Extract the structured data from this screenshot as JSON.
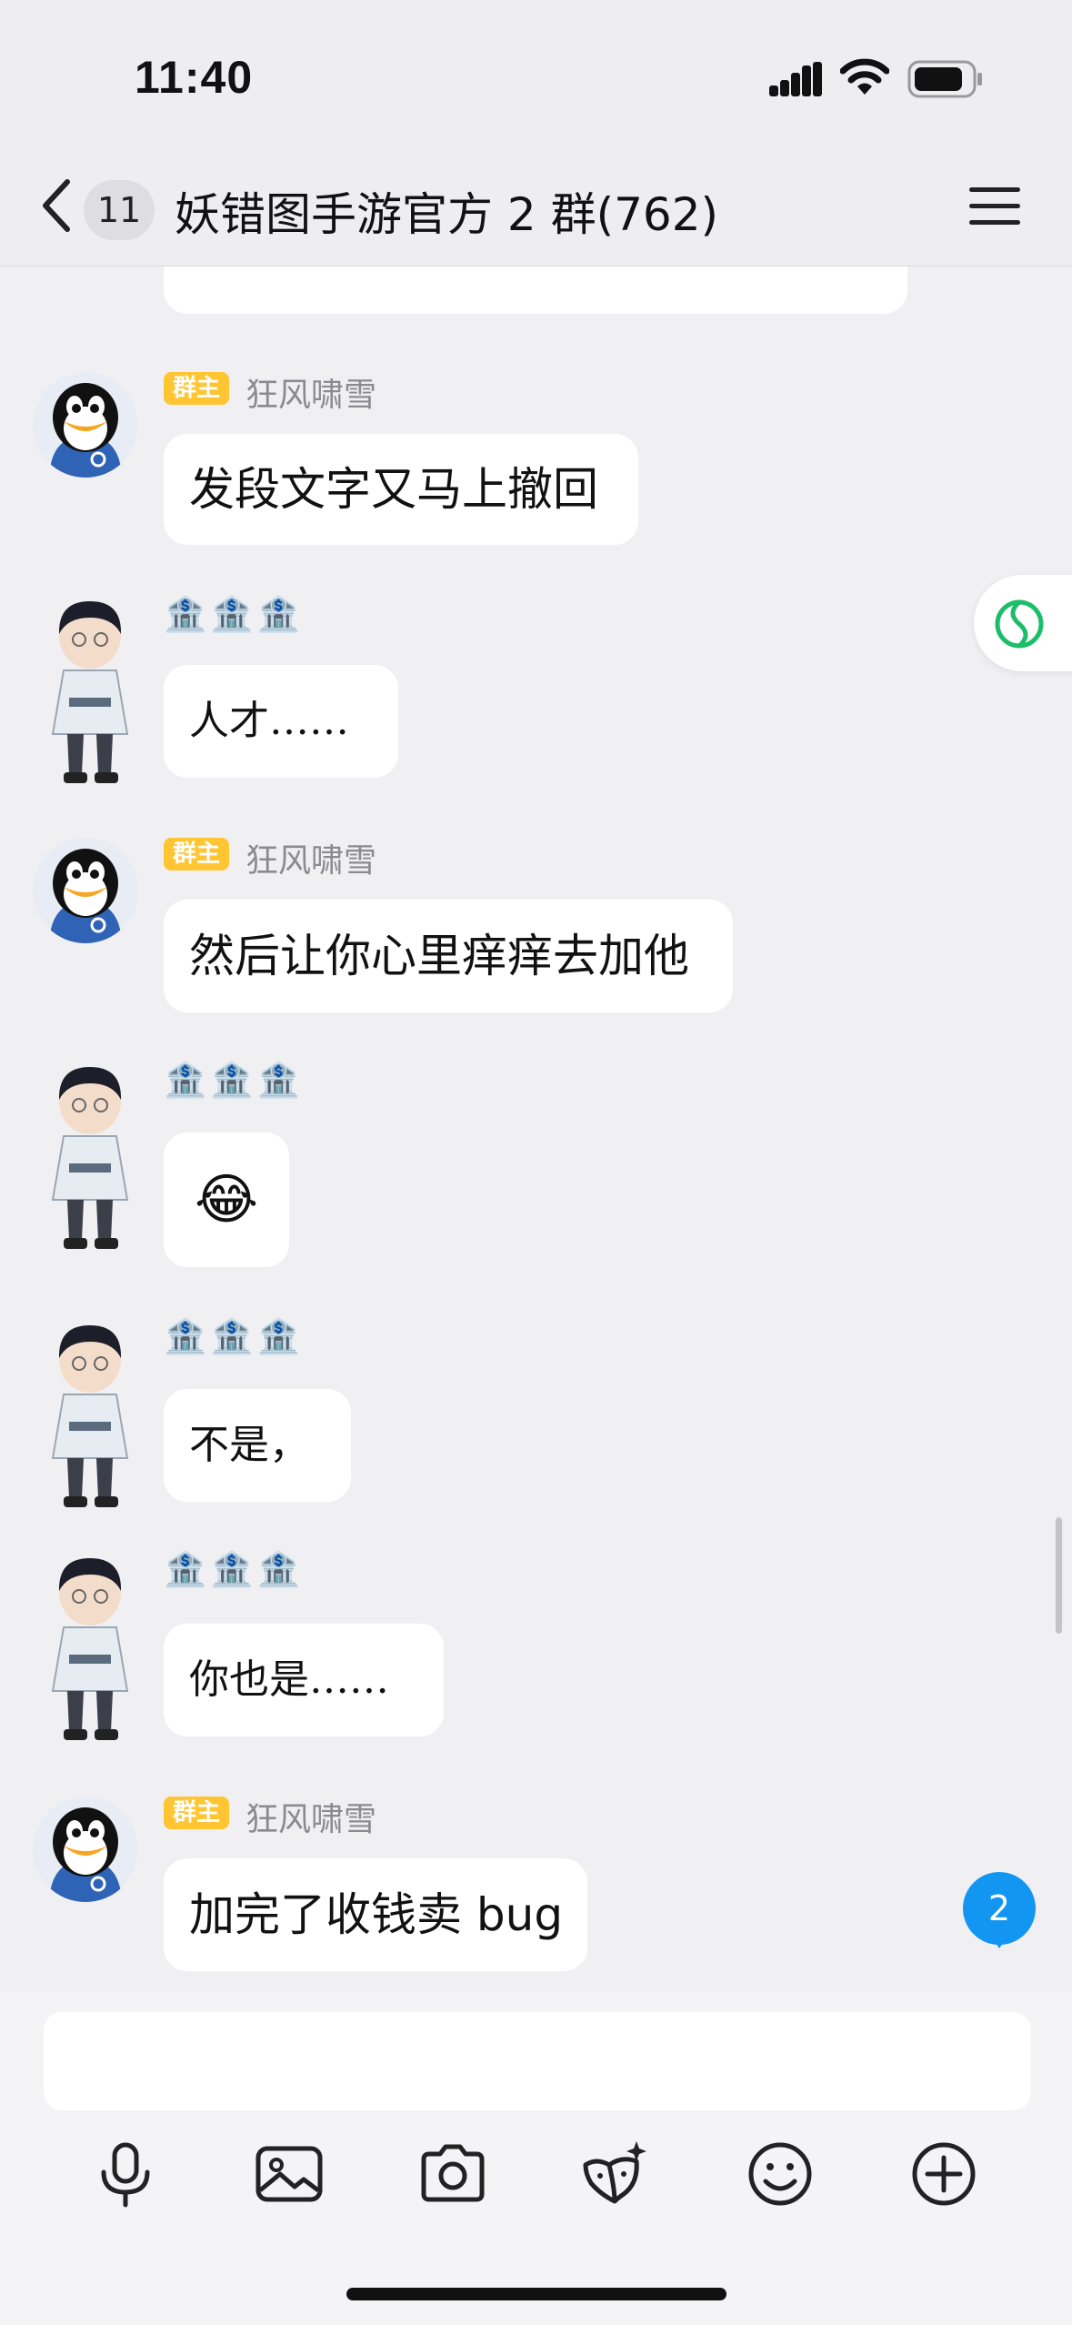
{
  "status_bar": {
    "time": "11:40"
  },
  "header": {
    "unread_count": "11",
    "title": "妖错图手游官方 2 群(762)"
  },
  "messages": [
    {
      "badge": "群主",
      "sender": "狂风啸雪",
      "text": "发段文字又马上撤回"
    },
    {
      "sender_emojis": "🏦🏦🏦",
      "text": "人才……"
    },
    {
      "badge": "群主",
      "sender": "狂风啸雪",
      "text": "然后让你心里痒痒去加他"
    },
    {
      "sender_emojis": "🏦🏦🏦",
      "text": "😂"
    },
    {
      "sender_emojis": "🏦🏦🏦",
      "text": "不是，"
    },
    {
      "sender_emojis": "🏦🏦🏦",
      "text": "你也是……"
    },
    {
      "badge": "群主",
      "sender": "狂风啸雪",
      "text": "加完了收钱卖 bug"
    }
  ],
  "new_message_count": "2",
  "input": {
    "placeholder": ""
  },
  "toolbar": [
    "microphone-icon",
    "image-icon",
    "camera-icon",
    "sticker-icon",
    "emoji-icon",
    "plus-icon"
  ]
}
